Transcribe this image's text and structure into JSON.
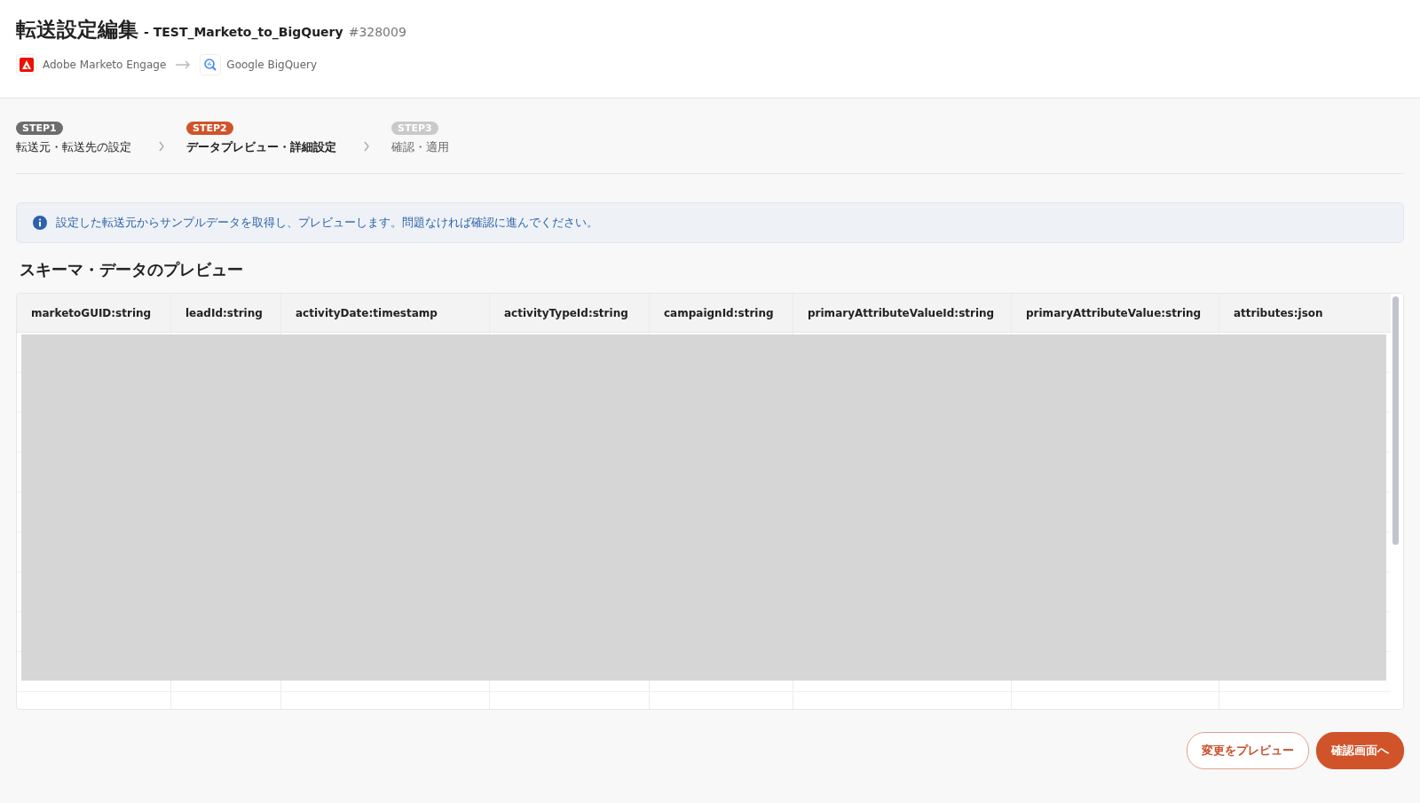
{
  "header": {
    "title": "転送設定編集",
    "subtitle": "- TEST_Marketo_to_BigQuery",
    "id": "#328009",
    "source": "Adobe Marketo Engage",
    "destination": "Google BigQuery"
  },
  "steps": [
    {
      "badge": "STEP1",
      "label": "転送元・転送先の設定",
      "kind": "done"
    },
    {
      "badge": "STEP2",
      "label": "データプレビュー・詳細設定",
      "kind": "current"
    },
    {
      "badge": "STEP3",
      "label": "確認・適用",
      "kind": "todo"
    }
  ],
  "info": "設定した転送元からサンプルデータを取得し、プレビューします。問題なければ確認に進んでください。",
  "section_title": "スキーマ・データのプレビュー",
  "table": {
    "columns": [
      "marketoGUID:string",
      "leadId:string",
      "activityDate:timestamp",
      "activityTypeId:string",
      "campaignId:string",
      "primaryAttributeValueId:string",
      "primaryAttributeValue:string",
      "attributes:json"
    ]
  },
  "buttons": [
    {
      "label": "変更をプレビュー",
      "kind": "secondary"
    },
    {
      "label": "確認画面へ",
      "kind": "primary"
    }
  ]
}
